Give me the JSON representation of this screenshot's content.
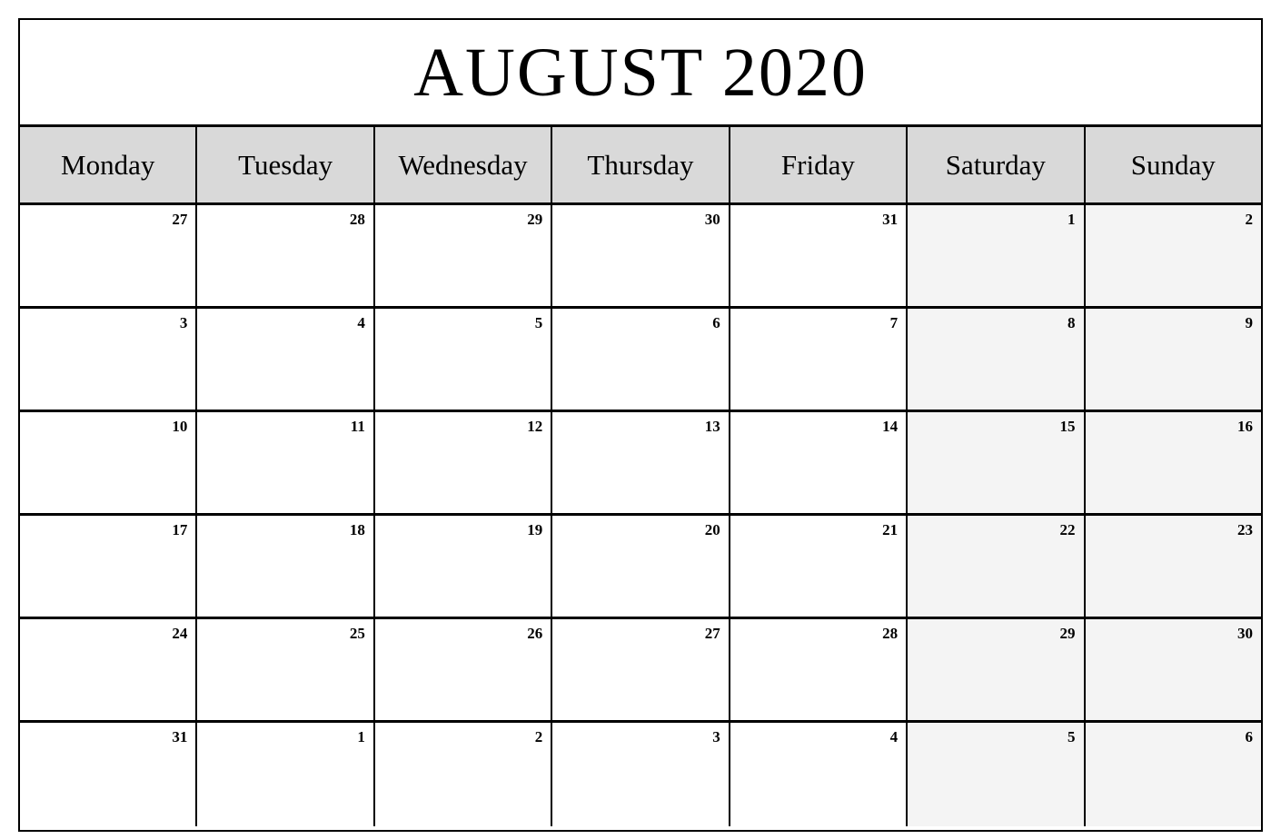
{
  "calendar": {
    "title": "AUGUST 2020",
    "month": "August",
    "year": "2020",
    "weekday_headers": [
      "Monday",
      "Tuesday",
      "Wednesday",
      "Thursday",
      "Friday",
      "Saturday",
      "Sunday"
    ],
    "weekend_columns": [
      5,
      6
    ],
    "colors": {
      "header_background": "#d9d9d9",
      "weekend_background": "#f4f4f4",
      "cell_background": "#ffffff",
      "border": "#000000",
      "text": "#000000"
    },
    "weeks": [
      [
        {
          "day": "27",
          "in_month": false
        },
        {
          "day": "28",
          "in_month": false
        },
        {
          "day": "29",
          "in_month": false
        },
        {
          "day": "30",
          "in_month": false
        },
        {
          "day": "31",
          "in_month": false
        },
        {
          "day": "1",
          "in_month": true
        },
        {
          "day": "2",
          "in_month": true
        }
      ],
      [
        {
          "day": "3",
          "in_month": true
        },
        {
          "day": "4",
          "in_month": true
        },
        {
          "day": "5",
          "in_month": true
        },
        {
          "day": "6",
          "in_month": true
        },
        {
          "day": "7",
          "in_month": true
        },
        {
          "day": "8",
          "in_month": true
        },
        {
          "day": "9",
          "in_month": true
        }
      ],
      [
        {
          "day": "10",
          "in_month": true
        },
        {
          "day": "11",
          "in_month": true
        },
        {
          "day": "12",
          "in_month": true
        },
        {
          "day": "13",
          "in_month": true
        },
        {
          "day": "14",
          "in_month": true
        },
        {
          "day": "15",
          "in_month": true
        },
        {
          "day": "16",
          "in_month": true
        }
      ],
      [
        {
          "day": "17",
          "in_month": true
        },
        {
          "day": "18",
          "in_month": true
        },
        {
          "day": "19",
          "in_month": true
        },
        {
          "day": "20",
          "in_month": true
        },
        {
          "day": "21",
          "in_month": true
        },
        {
          "day": "22",
          "in_month": true
        },
        {
          "day": "23",
          "in_month": true
        }
      ],
      [
        {
          "day": "24",
          "in_month": true
        },
        {
          "day": "25",
          "in_month": true
        },
        {
          "day": "26",
          "in_month": true
        },
        {
          "day": "27",
          "in_month": true
        },
        {
          "day": "28",
          "in_month": true
        },
        {
          "day": "29",
          "in_month": true
        },
        {
          "day": "30",
          "in_month": true
        }
      ],
      [
        {
          "day": "31",
          "in_month": true
        },
        {
          "day": "1",
          "in_month": false
        },
        {
          "day": "2",
          "in_month": false
        },
        {
          "day": "3",
          "in_month": false
        },
        {
          "day": "4",
          "in_month": false
        },
        {
          "day": "5",
          "in_month": false
        },
        {
          "day": "6",
          "in_month": false
        }
      ]
    ]
  }
}
